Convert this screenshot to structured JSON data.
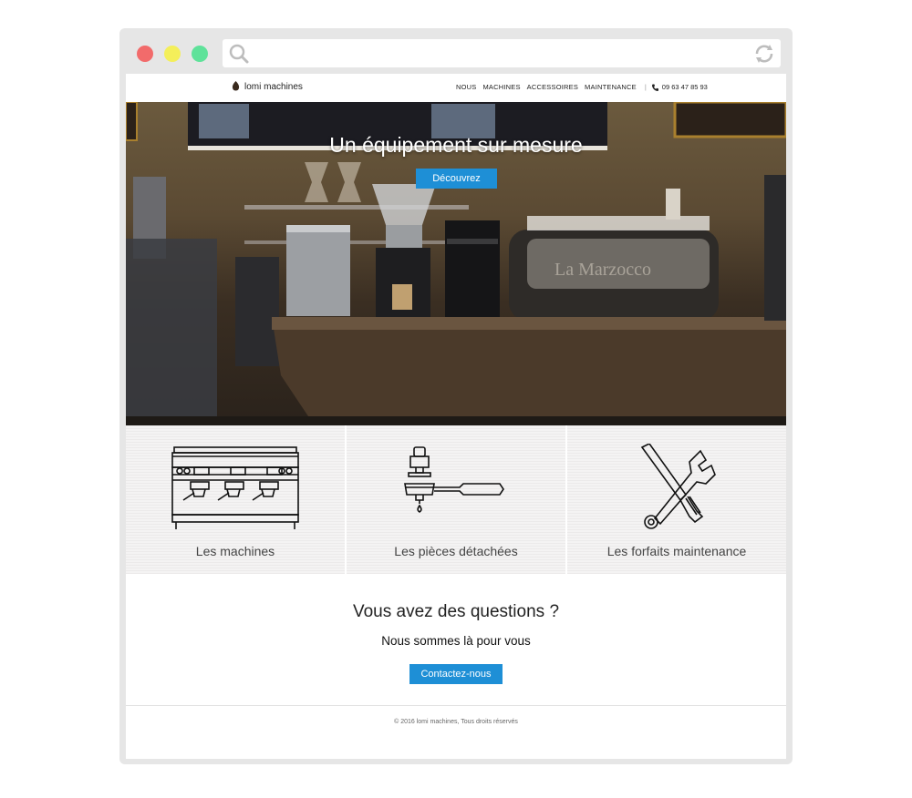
{
  "browser": {
    "icons": [
      "search-icon",
      "refresh-icon"
    ],
    "url": ""
  },
  "site": {
    "logo_text": "lomi machines",
    "nav": [
      "NOUS",
      "MACHINES",
      "ACCESSOIRES",
      "MAINTENANCE"
    ],
    "phone": "09 63 47 85 93"
  },
  "hero": {
    "title": "Un équipement sur mesure",
    "button": "Découvrez"
  },
  "features": [
    {
      "label": "Les machines",
      "icon": "espresso-machine-icon"
    },
    {
      "label": "Les pièces détachées",
      "icon": "portafilter-icon"
    },
    {
      "label": "Les forfaits maintenance",
      "icon": "tools-icon"
    }
  ],
  "contact": {
    "title": "Vous avez des questions ?",
    "subtitle": "Nous sommes là pour vous",
    "button": "Contactez-nous"
  },
  "footer": {
    "copyright": "© 2016 lomi machines, Tous droits réservés"
  },
  "colors": {
    "accent": "#1e8fd6",
    "close": "#f26b6b",
    "minimize": "#f4ef5a",
    "maximize": "#5fe29a"
  }
}
